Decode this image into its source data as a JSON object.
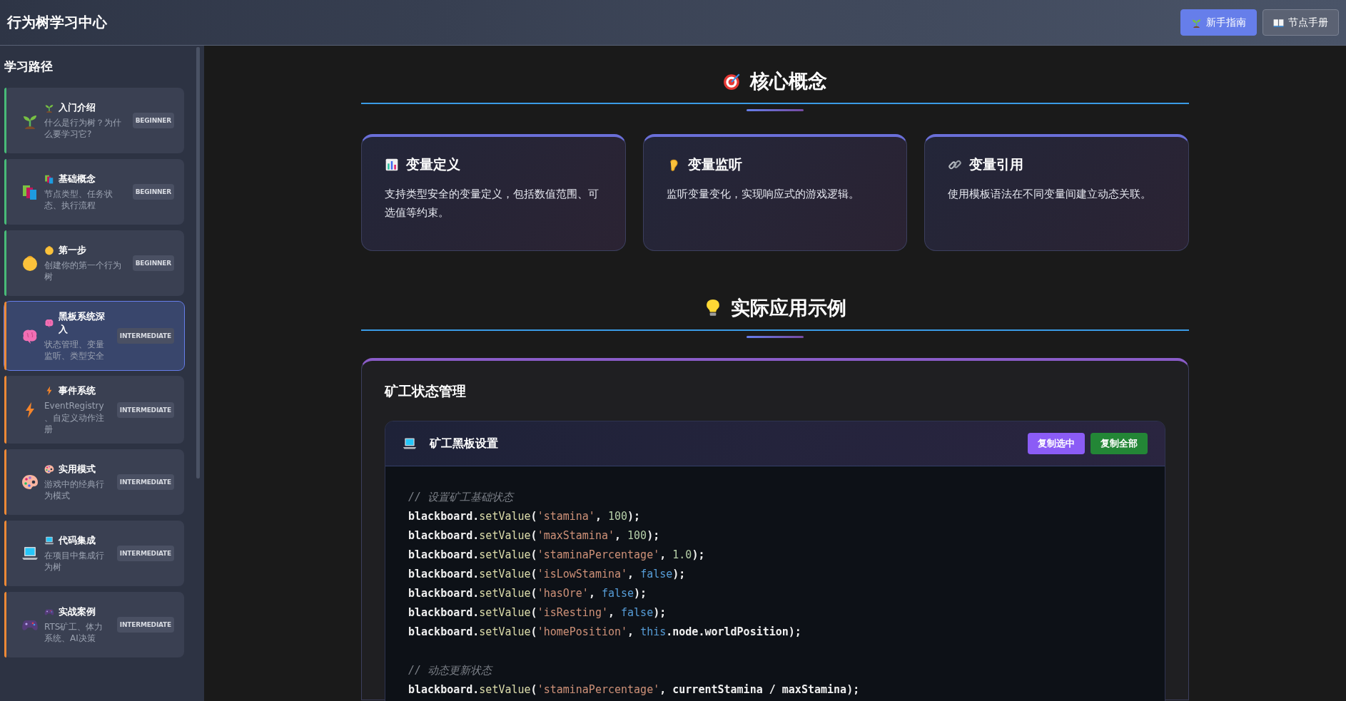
{
  "header": {
    "title": "行为树学习中心",
    "buttons": [
      {
        "label": "新手指南",
        "kind": "primary"
      },
      {
        "label": "节点手册",
        "kind": "secondary"
      }
    ]
  },
  "sidebar": {
    "title": "学习路径",
    "items": [
      {
        "title": "入门介绍",
        "description": "什么是行为树？为什么要学习它?",
        "badge": "BEGINNER",
        "color": "#48bb78",
        "selected": false
      },
      {
        "title": "基础概念",
        "description": "节点类型、任务状态、执行流程",
        "badge": "BEGINNER",
        "color": "#48bb78",
        "selected": false
      },
      {
        "title": "第一步",
        "description": "创建你的第一个行为树",
        "badge": "BEGINNER",
        "color": "#48bb78",
        "selected": false
      },
      {
        "title": "黑板系统深入",
        "description": "状态管理、变量监听、类型安全",
        "badge": "INTERMEDIATE",
        "color": "#ed8936",
        "selected": true
      },
      {
        "title": "事件系统",
        "description": "EventRegistry、自定义动作注册",
        "badge": "INTERMEDIATE",
        "color": "#ed8936",
        "selected": false
      },
      {
        "title": "实用模式",
        "description": "游戏中的经典行为模式",
        "badge": "INTERMEDIATE",
        "color": "#ed8936",
        "selected": false
      },
      {
        "title": "代码集成",
        "description": "在项目中集成行为树",
        "badge": "INTERMEDIATE",
        "color": "#ed8936",
        "selected": false
      },
      {
        "title": "实战案例",
        "description": "RTS矿工、体力系统、AI决策",
        "badge": "INTERMEDIATE",
        "color": "#ed8936",
        "selected": false
      }
    ]
  },
  "sections": [
    {
      "title": "核心概念",
      "cards": [
        {
          "title": "变量定义",
          "description": "支持类型安全的变量定义，包括数值范围、可选值等约束。"
        },
        {
          "title": "变量监听",
          "description": "监听变量变化，实现响应式的游戏逻辑。"
        },
        {
          "title": "变量引用",
          "description": "使用模板语法在不同变量间建立动态关联。"
        }
      ]
    },
    {
      "title": "实际应用示例",
      "example": {
        "title": "矿工状态管理",
        "code_block": {
          "title": "矿工黑板设置",
          "buttons": [
            {
              "label": "复制选中",
              "kind": "purple"
            },
            {
              "label": "复制全部",
              "kind": "green"
            }
          ],
          "lines": [
            {
              "kind": "code",
              "tokens": [
                {
                  "kind": "comment",
                  "text": "// 设置矿工基础状态"
                }
              ]
            },
            {
              "kind": "code",
              "tokens": [
                {
                  "kind": "ident",
                  "text": "blackboard."
                },
                {
                  "kind": "method",
                  "text": "setValue"
                },
                {
                  "kind": "plain",
                  "text": "("
                },
                {
                  "kind": "string",
                  "text": "'stamina'"
                },
                {
                  "kind": "plain",
                  "text": ", "
                },
                {
                  "kind": "number",
                  "text": "100"
                },
                {
                  "kind": "plain",
                  "text": ");"
                }
              ]
            },
            {
              "kind": "code",
              "tokens": [
                {
                  "kind": "ident",
                  "text": "blackboard."
                },
                {
                  "kind": "method",
                  "text": "setValue"
                },
                {
                  "kind": "plain",
                  "text": "("
                },
                {
                  "kind": "string",
                  "text": "'maxStamina'"
                },
                {
                  "kind": "plain",
                  "text": ", "
                },
                {
                  "kind": "number",
                  "text": "100"
                },
                {
                  "kind": "plain",
                  "text": ");"
                }
              ]
            },
            {
              "kind": "code",
              "tokens": [
                {
                  "kind": "ident",
                  "text": "blackboard."
                },
                {
                  "kind": "method",
                  "text": "setValue"
                },
                {
                  "kind": "plain",
                  "text": "("
                },
                {
                  "kind": "string",
                  "text": "'staminaPercentage'"
                },
                {
                  "kind": "plain",
                  "text": ", "
                },
                {
                  "kind": "number",
                  "text": "1.0"
                },
                {
                  "kind": "plain",
                  "text": ");"
                }
              ]
            },
            {
              "kind": "code",
              "tokens": [
                {
                  "kind": "ident",
                  "text": "blackboard."
                },
                {
                  "kind": "method",
                  "text": "setValue"
                },
                {
                  "kind": "plain",
                  "text": "("
                },
                {
                  "kind": "string",
                  "text": "'isLowStamina'"
                },
                {
                  "kind": "plain",
                  "text": ", "
                },
                {
                  "kind": "keyword",
                  "text": "false"
                },
                {
                  "kind": "plain",
                  "text": ");"
                }
              ]
            },
            {
              "kind": "code",
              "tokens": [
                {
                  "kind": "ident",
                  "text": "blackboard."
                },
                {
                  "kind": "method",
                  "text": "setValue"
                },
                {
                  "kind": "plain",
                  "text": "("
                },
                {
                  "kind": "string",
                  "text": "'hasOre'"
                },
                {
                  "kind": "plain",
                  "text": ", "
                },
                {
                  "kind": "keyword",
                  "text": "false"
                },
                {
                  "kind": "plain",
                  "text": ");"
                }
              ]
            },
            {
              "kind": "code",
              "tokens": [
                {
                  "kind": "ident",
                  "text": "blackboard."
                },
                {
                  "kind": "method",
                  "text": "setValue"
                },
                {
                  "kind": "plain",
                  "text": "("
                },
                {
                  "kind": "string",
                  "text": "'isResting'"
                },
                {
                  "kind": "plain",
                  "text": ", "
                },
                {
                  "kind": "keyword",
                  "text": "false"
                },
                {
                  "kind": "plain",
                  "text": ");"
                }
              ]
            },
            {
              "kind": "code",
              "tokens": [
                {
                  "kind": "ident",
                  "text": "blackboard."
                },
                {
                  "kind": "method",
                  "text": "setValue"
                },
                {
                  "kind": "plain",
                  "text": "("
                },
                {
                  "kind": "string",
                  "text": "'homePosition'"
                },
                {
                  "kind": "plain",
                  "text": ", "
                },
                {
                  "kind": "keyword",
                  "text": "this"
                },
                {
                  "kind": "ident",
                  "text": ".node.worldPosition"
                },
                {
                  "kind": "plain",
                  "text": ");"
                }
              ]
            },
            {
              "kind": "blank"
            },
            {
              "kind": "code",
              "tokens": [
                {
                  "kind": "comment",
                  "text": "// 动态更新状态"
                }
              ]
            },
            {
              "kind": "code",
              "tokens": [
                {
                  "kind": "ident",
                  "text": "blackboard."
                },
                {
                  "kind": "method",
                  "text": "setValue"
                },
                {
                  "kind": "plain",
                  "text": "("
                },
                {
                  "kind": "string",
                  "text": "'staminaPercentage'"
                },
                {
                  "kind": "plain",
                  "text": ", "
                },
                {
                  "kind": "ident",
                  "text": "currentStamina / maxStamina"
                },
                {
                  "kind": "plain",
                  "text": ");"
                }
              ]
            }
          ]
        }
      }
    }
  ]
}
